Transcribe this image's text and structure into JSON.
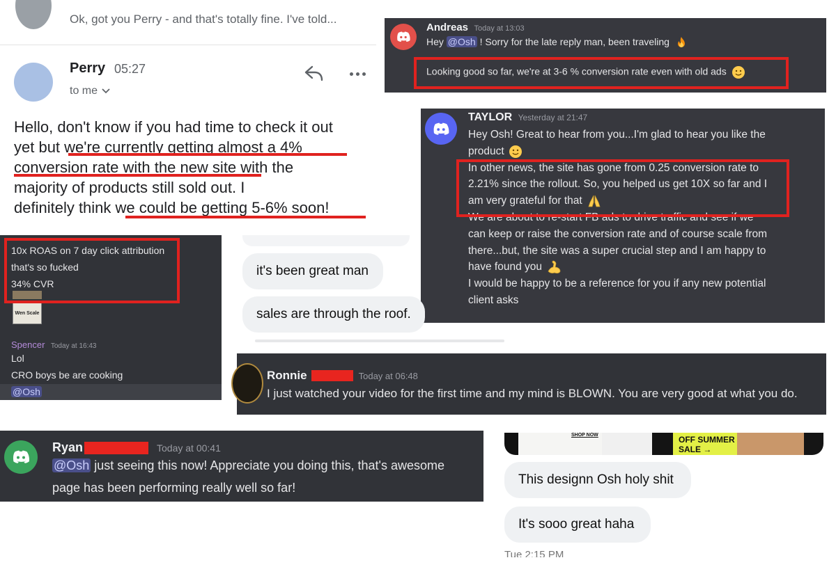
{
  "email": {
    "prev_preview": "Ok, got you Perry - and that's totally fine. I've told...",
    "sender": "Perry",
    "time": "05:27",
    "to_label": "to me",
    "body_lines": [
      "Hello, don't know if you had time to check it out",
      "yet but we're currently getting almost a 4%",
      "conversion rate with the new site with the",
      "majority of products still sold out. I",
      "definitely think we could be getting 5-6% soon!"
    ]
  },
  "andreas": {
    "name": "Andreas",
    "time": "Today at 13:03",
    "line1_pre": "Hey ",
    "mention": "@Osh",
    "line1_post": " ! Sorry for the late reply man, been traveling",
    "line2": "Looking good so far, we're at 3-6 % conversion rate even with old ads"
  },
  "taylor": {
    "name": "TAYLOR",
    "time": "Yesterday at 21:47",
    "lines": [
      "Hey Osh!  Great to hear from you...I'm glad to hear you like the",
      "product",
      "In other news, the site has gone from 0.25 conversion rate to",
      "2.21% since the rollout.  So, you helped us get 10X so far and I",
      "am very grateful for that",
      "We are about to re-start FB ads to drive traffic and see if we",
      "can keep or raise the conversion rate and of course scale from",
      "there...but, the site was a super crucial step and I am happy to",
      "have found you",
      "I would be happy to be a reference for you if any new potential",
      "client asks"
    ]
  },
  "roas": {
    "lines": [
      "10x ROAS on 7 day click attribution",
      "that's so fucked",
      "34% CVR"
    ],
    "thumb_label": "Wen Scale",
    "spencer_name": "Spencer",
    "spencer_time": "Today at 16:43",
    "msg1": "Lol",
    "msg2": "CRO boys be are cooking",
    "mention": "@Osh"
  },
  "chat1": {
    "bubble1": "it's been great man",
    "bubble2": "sales are through the roof."
  },
  "ronnie": {
    "name": "Ronnie",
    "time": "Today at 06:48",
    "message": "I just watched your video for the first time and my mind is BLOWN.  You are very good at what you do."
  },
  "ryan": {
    "name": "Ryan",
    "time": "Today at 00:41",
    "mention": "@Osh",
    "line1": " just seeing this now! Appreciate you doing this, that's awesome",
    "line2": "page has been performing really well so far!"
  },
  "chat2": {
    "shop_now": "SHOP NOW",
    "banner_line1": "OFF SUMMER",
    "banner_line2": "SALE →",
    "bubble1": "This designn Osh holy shit",
    "bubble2": "It's sooo great haha",
    "timestamp": "Tue 2:15 PM"
  },
  "colors": {
    "highlight_red": "#e0221f",
    "discord_bg": "#37383e",
    "discord_red_avatar": "#e2504a",
    "discord_blurple": "#5865f2",
    "discord_green_avatar": "#3ba55d",
    "spencer_purple": "#b48bd9",
    "banner_yellow": "#e3f046"
  },
  "icons": [
    "reply-icon",
    "more-icon",
    "chevron-down-icon",
    "discord-logo-icon",
    "fire-emoji",
    "smile-emoji",
    "pray-emoji",
    "muscle-emoji"
  ]
}
